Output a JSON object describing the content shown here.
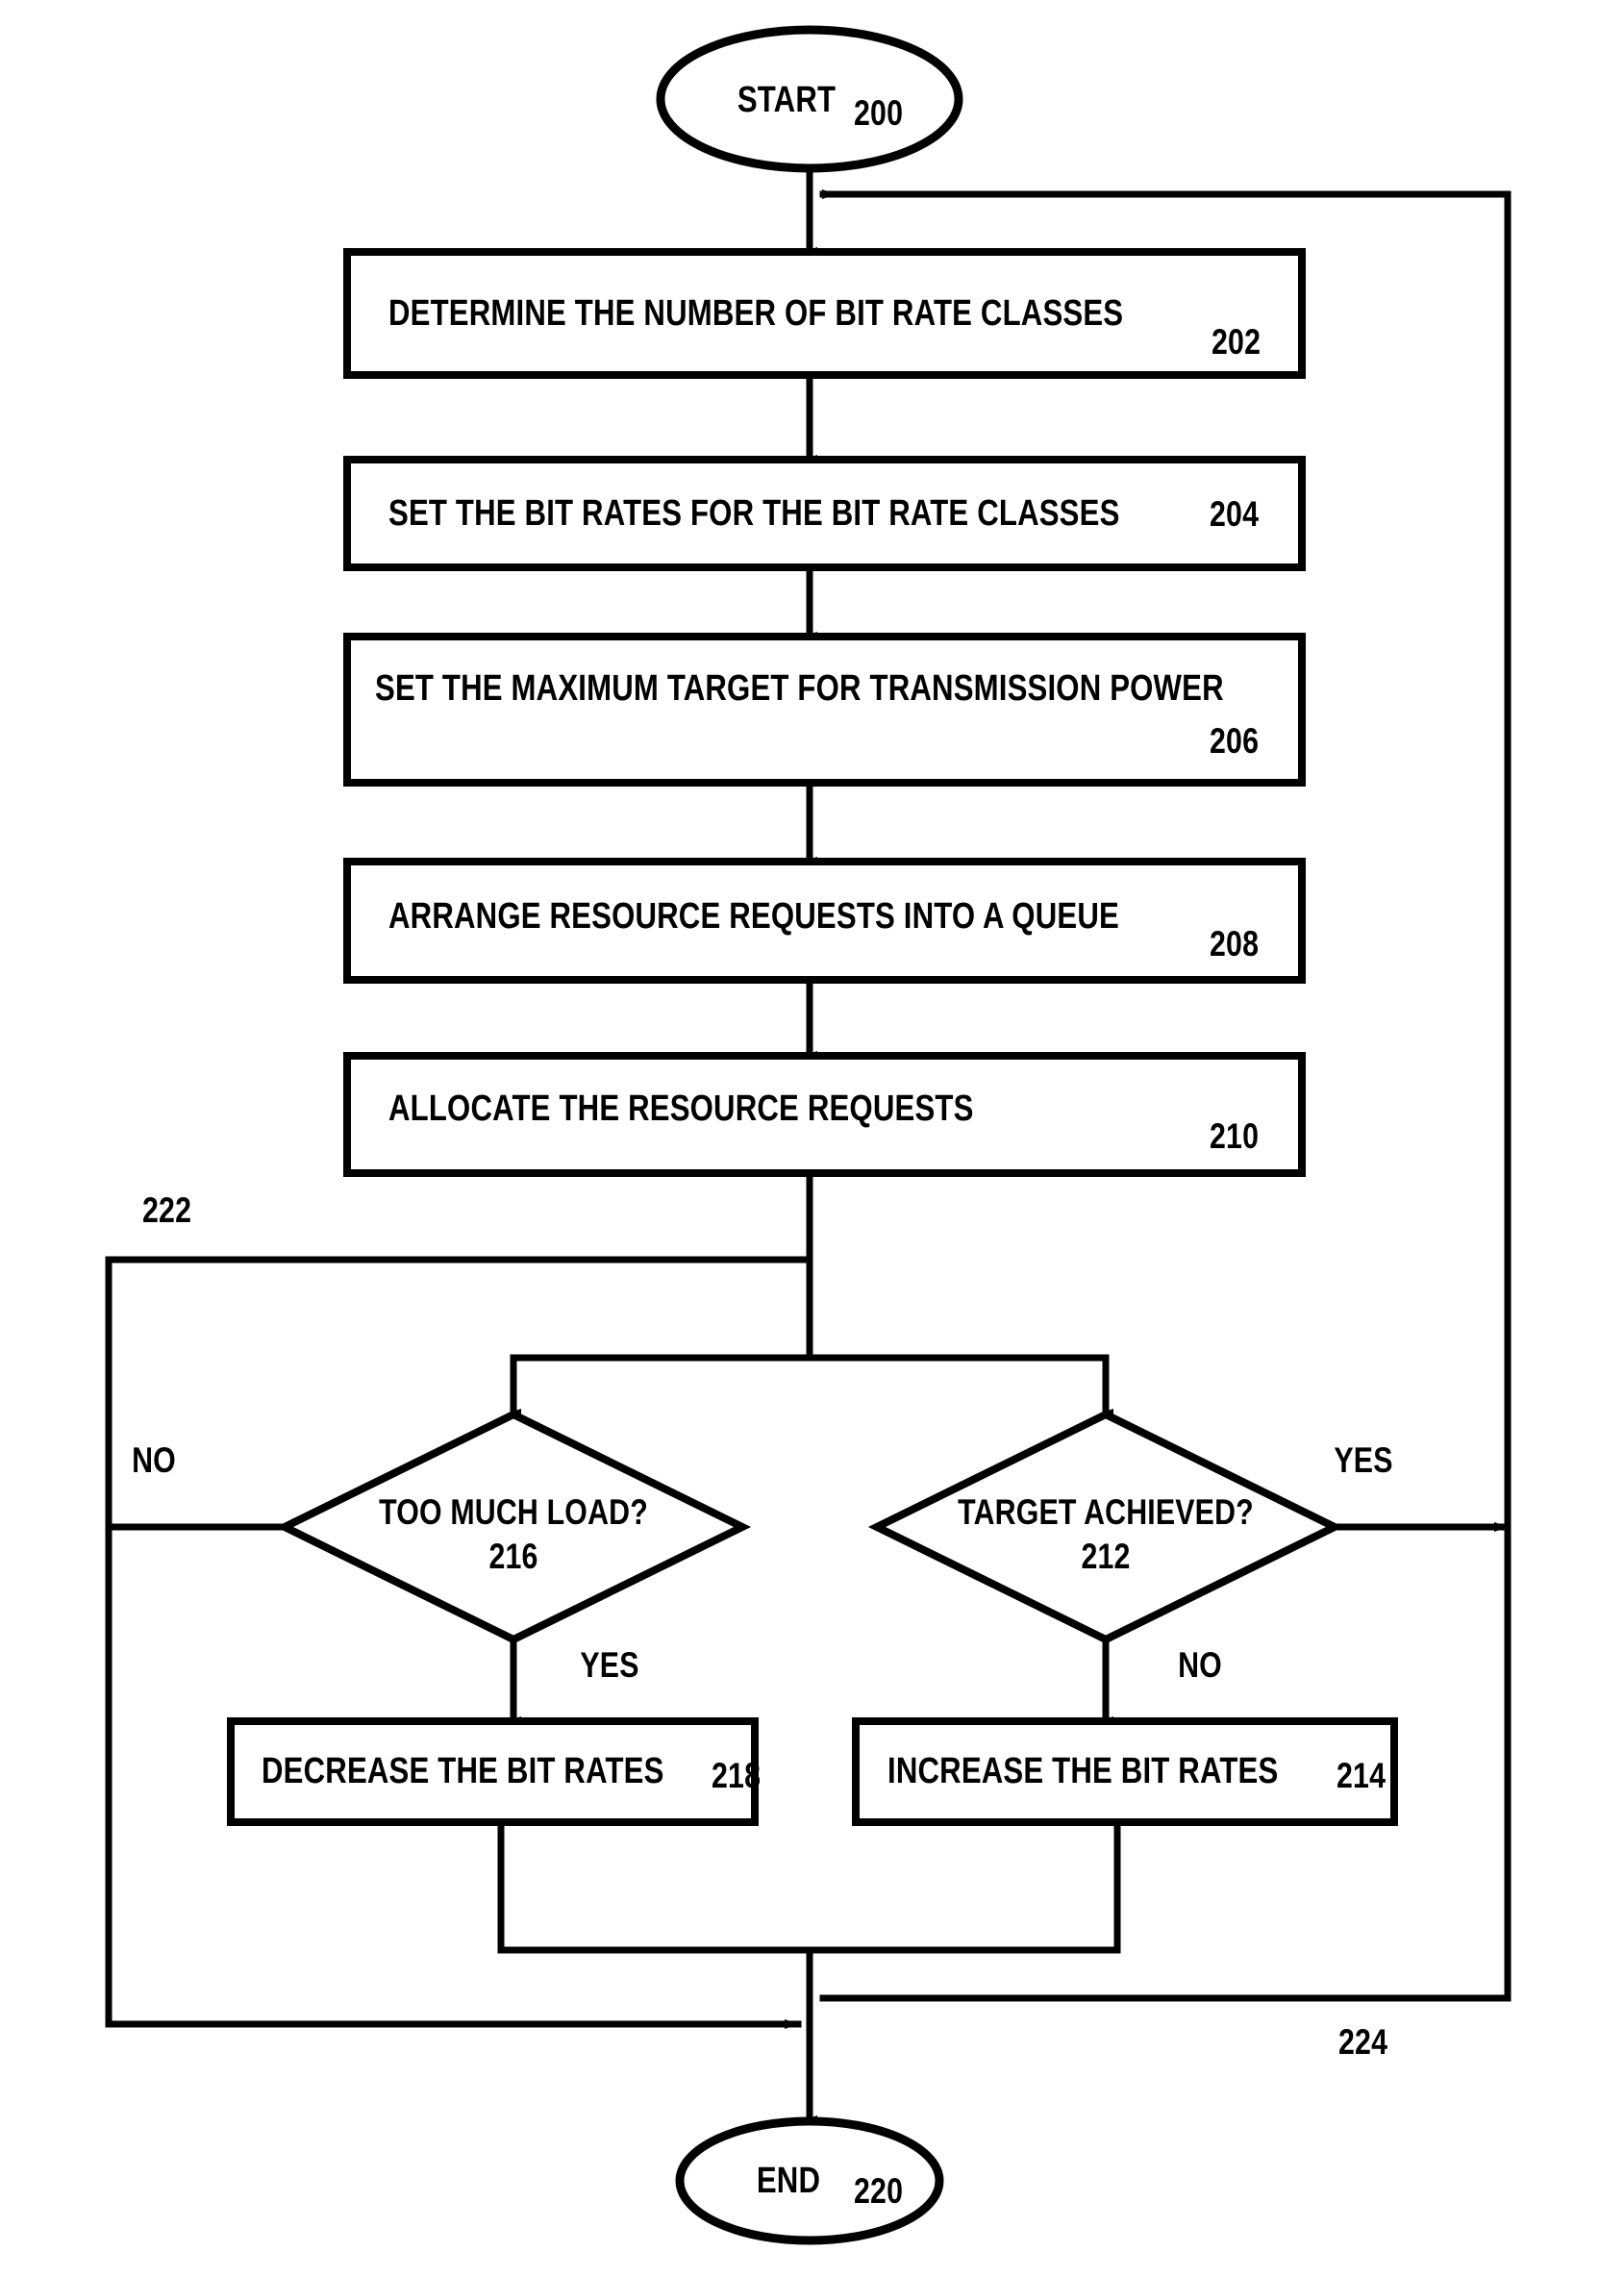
{
  "figure": {
    "type": "patent-flowchart",
    "title_visible": false,
    "background_color": "#ffffff",
    "line_color": "#000000",
    "text_color": "#000000"
  },
  "nodes": {
    "start": {
      "label": "START",
      "ref": "200",
      "shape": "ellipse"
    },
    "step202": {
      "label": "DETERMINE THE NUMBER OF BIT RATE CLASSES",
      "ref": "202",
      "shape": "rect"
    },
    "step204": {
      "label": "SET THE BIT RATES FOR THE BIT RATE CLASSES",
      "ref": "204",
      "shape": "rect"
    },
    "step206": {
      "label": "SET THE MAXIMUM TARGET FOR TRANSMISSION POWER",
      "ref": "206",
      "shape": "rect"
    },
    "step208": {
      "label": "ARRANGE RESOURCE REQUESTS INTO A QUEUE",
      "ref": "208",
      "shape": "rect"
    },
    "step210": {
      "label": "ALLOCATE THE RESOURCE REQUESTS",
      "ref": "210",
      "shape": "rect"
    },
    "decision216": {
      "label": "TOO MUCH LOAD?",
      "ref": "216",
      "shape": "diamond"
    },
    "decision212": {
      "label": "TARGET ACHIEVED?",
      "ref": "212",
      "shape": "diamond"
    },
    "step218": {
      "label": "DECREASE THE BIT RATES",
      "ref": "218",
      "shape": "rect"
    },
    "step214": {
      "label": "INCREASE THE BIT RATES",
      "ref": "214",
      "shape": "rect"
    },
    "end": {
      "label": "END",
      "ref": "220",
      "shape": "ellipse"
    }
  },
  "edge_labels": {
    "no_left": "NO",
    "yes_right": "YES",
    "yes_below_216": "YES",
    "no_below_212": "NO",
    "path_222": "222",
    "path_224": "224"
  }
}
